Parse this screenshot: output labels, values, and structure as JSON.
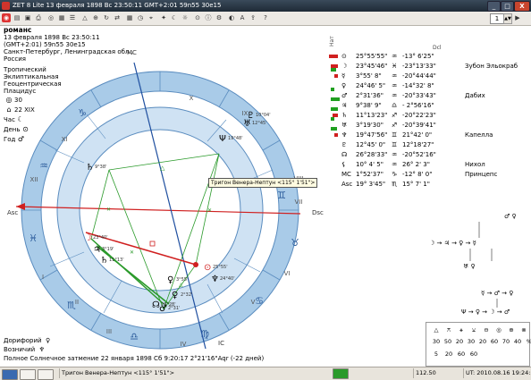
{
  "window": {
    "title": "ZET 8 Lite   13 февраля 1898  Вс  23:50:11 GMT+2:01 59n55  30e15",
    "minimize": "_",
    "maximize": "□",
    "close": "X"
  },
  "toolbar": {
    "page_number": "1"
  },
  "chart_info": {
    "name": "романс",
    "datetime": "13 февраля 1898  Вс  23:50:11 (GMT+2:01) 59n55  30e15",
    "place": "Санкт-Петербург, Ленинградская обл., Россия",
    "zodiac": "Тропический",
    "type": "Эклиптикальная",
    "center": "Геоцентрическая",
    "houses": "Плацидус",
    "day_number": "30",
    "arcana": "22 XIX",
    "hour_label": "Час",
    "day_label": "День",
    "year_label": "Год"
  },
  "wheel": {
    "angle_labels": {
      "asc": "Asc",
      "dsc": "Dsc",
      "mc": "MC",
      "ic": "IC"
    },
    "house_labels": [
      "I",
      "II",
      "III",
      "IV",
      "V",
      "VI",
      "VII",
      "VIII",
      "IX",
      "X",
      "XI",
      "XII"
    ],
    "inner_planet_labels": [
      {
        "sym": "♄",
        "deg": "9°38'"
      },
      {
        "sym": "☽",
        "deg": "23°40'"
      },
      {
        "sym": "♃",
        "deg": "3°19'"
      },
      {
        "sym": "♄",
        "deg": "11°13'"
      },
      {
        "sym": "♀",
        "deg": "3°55'"
      },
      {
        "sym": "♀",
        "deg": "2°32'"
      },
      {
        "sym": "♂",
        "deg": "2°31'"
      },
      {
        "sym": "☊",
        "deg": "26°28'"
      },
      {
        "sym": "⊙",
        "deg": "25°55'"
      },
      {
        "sym": "♆",
        "deg": "24°40'"
      },
      {
        "sym": "Ψ",
        "deg": "19°48'"
      },
      {
        "sym": "♅",
        "deg": "12°45'"
      },
      {
        "sym": "♇",
        "deg": "10°04'"
      }
    ]
  },
  "tooltip": "Тригон Венера-Нептун <115° 1'51\">",
  "planet_table": {
    "header_left": "Нат",
    "header_decl": "Dcl",
    "rows": [
      {
        "sym": "⊙",
        "sign": "♒",
        "lon": "25°55'55\"",
        "decl": "-13° 6'25\"",
        "note": "",
        "red": 10,
        "green": 0
      },
      {
        "sym": "☽",
        "sign": "♓",
        "lon": "23°45'46\"",
        "decl": "-23°13'33\"",
        "note": "Зубон Эльокраб",
        "red": 8,
        "green": 6
      },
      {
        "sym": "☿",
        "sign": "♒",
        "lon": "3°55' 8\"",
        "decl": "-20°44'44\"",
        "note": "",
        "red": 4,
        "green": 0
      },
      {
        "sym": "♀",
        "sign": "♒",
        "lon": "24°46' 5\"",
        "decl": "-14°32' 8\"",
        "note": "",
        "red": 0,
        "green": 4
      },
      {
        "sym": "♂",
        "sign": "♒",
        "lon": "2°31'36\"",
        "decl": "-20°33'43\"",
        "note": "Дабих",
        "red": 0,
        "green": 10
      },
      {
        "sym": "♃",
        "sign": "♎",
        "lon": "9°38' 9\"",
        "decl": "- 2°56'16\"",
        "note": "",
        "red": 0,
        "green": 8
      },
      {
        "sym": "♄",
        "sign": "♐",
        "lon": "11°13'23\"",
        "decl": "-20°22'23\"",
        "note": "",
        "red": 6,
        "green": 4
      },
      {
        "sym": "♅",
        "sign": "♐",
        "lon": "3°19'30\"",
        "decl": "-20°39'41\"",
        "note": "",
        "red": 0,
        "green": 7
      },
      {
        "sym": "♆",
        "sign": "♊",
        "lon": "19°47'56\"",
        "decl": "21°42' 0\"",
        "note": "Капелла",
        "red": 4,
        "green": 0
      },
      {
        "sym": "♇",
        "sign": "♊",
        "lon": "12°45' 0\"",
        "decl": "12°18'27\"",
        "note": "",
        "red": 0,
        "green": 0
      },
      {
        "sym": "☊",
        "sign": "♒",
        "lon": "26°28'33\"",
        "decl": "-20°52'16\"",
        "note": "",
        "red": 0,
        "green": 0
      },
      {
        "sym": "⚸",
        "sign": "♒",
        "lon": "10° 4' 5\"",
        "decl": "26° 2' 3\"",
        "note": "Нихол",
        "red": 0,
        "green": 0
      },
      {
        "sym": "MC",
        "sign": "♑",
        "lon": "1°52'37\"",
        "decl": "-12° 8' 0\"",
        "note": "Принцепс",
        "red": 0,
        "green": 0
      },
      {
        "sym": "Asc",
        "sign": "♏",
        "lon": "19° 3'45\"",
        "decl": "15° 7' 1\"",
        "note": "",
        "red": 0,
        "green": 0
      }
    ]
  },
  "dispositor": {
    "top": "♂ ♀",
    "mid": "☽ → ♃ → ♀ → ☿",
    "low": "♅ ♀",
    "bottom1": "☿ → ♂ → ♀",
    "bottom2": "Ψ → ♀ → ☽ → ♂"
  },
  "aspect_grid": {
    "symbols": [
      "△",
      "⚻",
      "⚹",
      "⚺",
      "⊖",
      "◎",
      "⊕",
      "⊗"
    ],
    "values_row1": [
      "30",
      "50",
      "20",
      "30",
      "20",
      "60",
      "70",
      "40",
      "%"
    ],
    "values_row2": [
      "5",
      "20",
      "60",
      "60"
    ]
  },
  "bottom_left": {
    "doriphory": "Дорифорий",
    "doriphory_sym": "♀",
    "vozniky": "Возничий",
    "vozniky_sym": "♆"
  },
  "eclipse": "Полное Солнечное затмение 22 января 1898  Сб  9:20:17   2°21'16\"Aqr (-22 дней)",
  "statusbar": {
    "aspect": "Тригон Венера-Нептун <115° 1'51\">",
    "coord": "112.50",
    "ut": "UT: 2010.08.16 19:24:27"
  }
}
